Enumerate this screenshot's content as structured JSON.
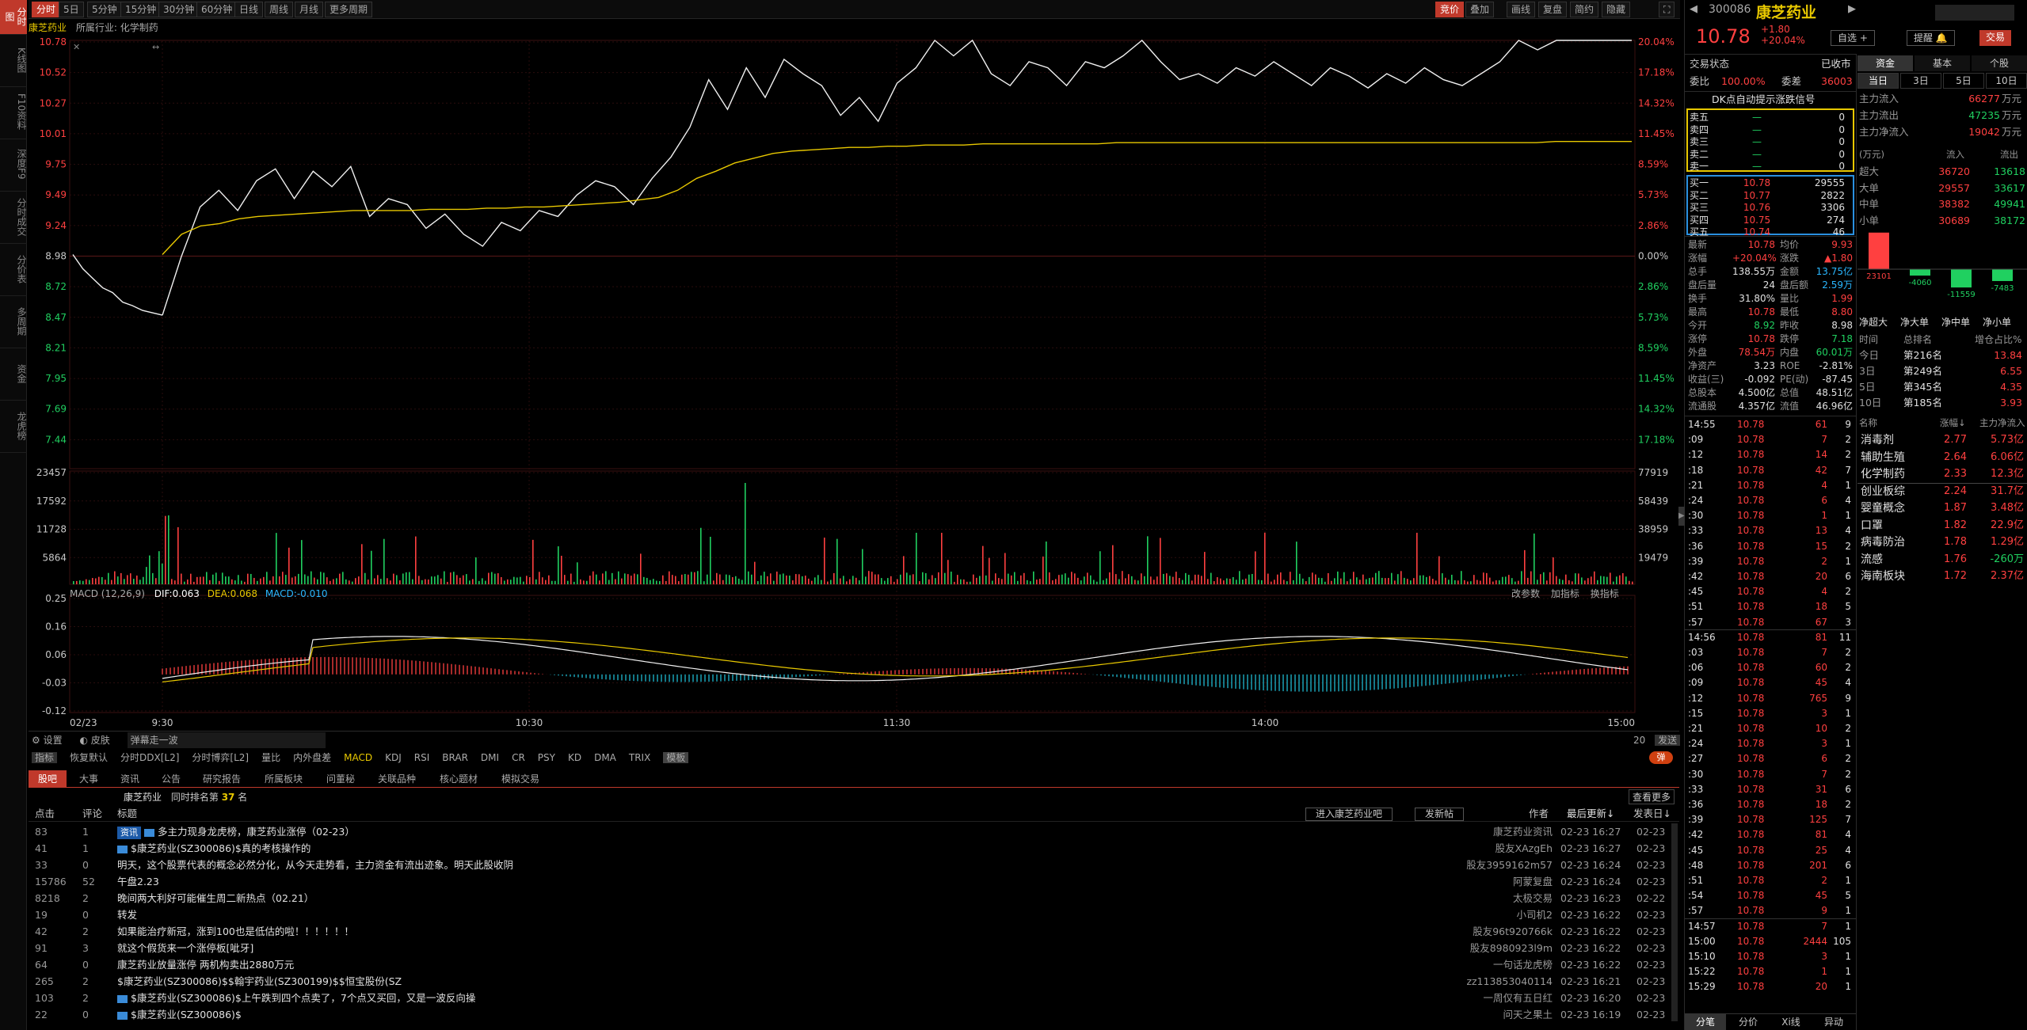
{
  "left_tabs": [
    {
      "label": "分时图",
      "active": true
    },
    {
      "label": "K线图",
      "active": false
    },
    {
      "label": "F10资料",
      "active": false
    },
    {
      "label": "深度F9",
      "active": false
    },
    {
      "label": "分时成交",
      "active": false
    },
    {
      "label": "分价表",
      "active": false
    },
    {
      "label": "多周期",
      "active": false
    },
    {
      "label": "资金",
      "active": false
    },
    {
      "label": "龙虎榜",
      "active": false
    }
  ],
  "period_buttons": [
    "分时",
    "5日",
    "5分钟",
    "15分钟",
    "30分钟",
    "60分钟",
    "日线",
    "周线",
    "月线",
    "更多周期"
  ],
  "right_buttons": [
    "竞价",
    "叠加",
    "画线",
    "复盘",
    "简约",
    "隐藏"
  ],
  "info": {
    "name": "康芝药业",
    "industry_label": "所属行业:",
    "industry": "化学制药"
  },
  "price_axis_left": [
    "10.78",
    "10.52",
    "10.27",
    "10.01",
    "9.75",
    "9.49",
    "9.24",
    "8.98",
    "8.72",
    "8.47",
    "8.21",
    "7.95",
    "7.69",
    "7.44"
  ],
  "pct_axis_right": [
    "20.04%",
    "17.18%",
    "14.32%",
    "11.45%",
    "8.59%",
    "5.73%",
    "2.86%",
    "0.00%",
    "2.86%",
    "5.73%",
    "8.59%",
    "11.45%",
    "14.32%",
    "17.18%"
  ],
  "vol_axis_left": [
    "23457",
    "17592",
    "11728",
    "5864"
  ],
  "vol_axis_right": [
    "77919",
    "58439",
    "38959",
    "19479"
  ],
  "macd": {
    "header": "MACD (12,26,9)",
    "dif_label": "DIF:",
    "dif": "0.063",
    "dea_label": "DEA:",
    "dea": "0.068",
    "macd_label": "MACD:",
    "macd_val": "-0.010",
    "axis": [
      "0.25",
      "0.16",
      "0.06",
      "-0.03",
      "-0.12"
    ],
    "tools": [
      "改参数",
      "加指标",
      "换指标"
    ]
  },
  "time_axis": [
    "02/23",
    "9:30",
    "10:30",
    "11:30",
    "14:00",
    "15:00"
  ],
  "chart_data": {
    "type": "line",
    "title": "",
    "prev_close": 8.98,
    "ylim": [
      7.18,
      10.78
    ],
    "series": [
      {
        "name": "",
        "values": [
          8.98,
          8.86,
          8.78,
          8.7,
          8.66,
          8.58,
          8.55,
          8.51,
          8.49,
          8.47,
          8.96,
          9.38,
          9.52,
          9.35,
          9.6,
          9.7,
          9.45,
          9.68,
          9.55,
          9.72,
          9.3,
          9.45,
          9.4,
          9.2,
          9.32,
          9.15,
          9.05,
          9.25,
          9.18,
          9.35,
          9.3,
          9.48,
          9.6,
          9.55,
          9.4,
          9.62,
          9.8,
          10.05,
          10.45,
          10.2,
          10.55,
          10.3,
          10.62,
          10.5,
          10.4,
          10.15,
          10.3,
          10.1,
          10.42,
          10.55,
          10.78,
          10.65,
          10.78,
          10.5,
          10.4,
          10.6,
          10.55,
          10.4,
          10.6,
          10.55,
          10.65,
          10.78,
          10.6,
          10.45,
          10.5,
          10.42,
          10.55,
          10.48,
          10.6,
          10.5,
          10.4,
          10.55,
          10.48,
          10.38,
          10.5,
          10.42,
          10.55,
          10.45,
          10.4,
          10.5,
          10.6,
          10.78,
          10.7,
          10.78,
          10.78,
          10.78,
          10.78,
          10.78
        ]
      },
      {
        "name": "",
        "values": [
          8.98,
          8.98,
          8.98,
          8.98,
          8.98,
          8.98,
          8.98,
          8.98,
          8.98,
          8.98,
          8.98,
          9.15,
          9.22,
          9.24,
          9.28,
          9.3,
          9.31,
          9.32,
          9.33,
          9.34,
          9.35,
          9.35,
          9.35,
          9.35,
          9.36,
          9.36,
          9.36,
          9.37,
          9.37,
          9.38,
          9.38,
          9.39,
          9.4,
          9.41,
          9.42,
          9.44,
          9.46,
          9.52,
          9.62,
          9.68,
          9.75,
          9.79,
          9.83,
          9.85,
          9.86,
          9.87,
          9.88,
          9.88,
          9.89,
          9.89,
          9.9,
          9.9,
          9.9,
          9.91,
          9.91,
          9.91,
          9.91,
          9.91,
          9.91,
          9.91,
          9.92,
          9.92,
          9.92,
          9.92,
          9.92,
          9.92,
          9.92,
          9.92,
          9.92,
          9.92,
          9.92,
          9.92,
          9.92,
          9.92,
          9.92,
          9.92,
          9.92,
          9.92,
          9.92,
          9.92,
          9.92,
          9.92,
          9.92,
          9.93,
          9.93,
          9.93,
          9.93,
          9.93
        ]
      }
    ]
  },
  "bottom_toolbar": {
    "settings": "设置",
    "skin": "皮肤",
    "marquee": "弹幕走一波",
    "count": "20",
    "send": "发送"
  },
  "indicator_tabs": [
    "指标",
    "恢复默认",
    "分时DDX[L2]",
    "分时博弈[L2]",
    "量比",
    "内外盘差",
    "MACD",
    "KDJ",
    "RSI",
    "BRAR",
    "DMI",
    "CR",
    "PSY",
    "KD",
    "DMA",
    "TRIX",
    "模板"
  ],
  "news_tabs": [
    "股吧",
    "大事",
    "资讯",
    "公告",
    "研究报告",
    "所属板块",
    "问董秘",
    "关联品种",
    "核心题材",
    "模拟交易"
  ],
  "news_subheader": {
    "stock": "康芝药业",
    "rank_label": "同时排名第",
    "rank": "37",
    "rank_suffix": "名",
    "more": "查看更多"
  },
  "news_columns": {
    "clicks": "点击",
    "comments": "评论",
    "title": "标题",
    "enter_bar": "进入康芝药业吧",
    "post": "发新帖",
    "author": "作者",
    "last_update": "最后更新↓",
    "posted": "发表日↓"
  },
  "news": [
    {
      "clicks": "83",
      "comments": "1",
      "tag": "资讯",
      "icon": true,
      "title": "多主力现身龙虎榜，康芝药业涨停（02-23）",
      "author": "康芝药业资讯",
      "update": "02-23 16:27",
      "date": "02-23"
    },
    {
      "clicks": "41",
      "comments": "1",
      "tag": "",
      "icon": true,
      "title": "$康芝药业(SZ300086)$真的考核操作的",
      "author": "股友XAzgEh",
      "update": "02-23 16:27",
      "date": "02-23"
    },
    {
      "clicks": "33",
      "comments": "0",
      "tag": "",
      "icon": false,
      "title": "明天，这个股票代表的概念必然分化，从今天走势看，主力资金有流出迹象。明天此股收阴",
      "author": "股友3959162m57",
      "update": "02-23 16:24",
      "date": "02-23"
    },
    {
      "clicks": "15786",
      "comments": "52",
      "tag": "",
      "icon": false,
      "title": "午盘2.23",
      "author": "阿蒙复盘",
      "update": "02-23 16:24",
      "date": "02-23"
    },
    {
      "clicks": "8218",
      "comments": "2",
      "tag": "",
      "icon": false,
      "title": "晚间两大利好可能催生周二新热点（02.21）",
      "author": "太极交易",
      "update": "02-23 16:23",
      "date": "02-22"
    },
    {
      "clicks": "19",
      "comments": "0",
      "tag": "",
      "icon": false,
      "title": "转发",
      "author": "小司机2",
      "update": "02-23 16:22",
      "date": "02-23"
    },
    {
      "clicks": "42",
      "comments": "2",
      "tag": "",
      "icon": false,
      "title": "如果能治疗新冠，涨到100也是低估的啦！！！！！！",
      "author": "股友96t920766k",
      "update": "02-23 16:22",
      "date": "02-23"
    },
    {
      "clicks": "91",
      "comments": "3",
      "tag": "",
      "icon": false,
      "title": "就这个假货来一个涨停板[呲牙]",
      "author": "股友8980923l9m",
      "update": "02-23 16:22",
      "date": "02-23"
    },
    {
      "clicks": "64",
      "comments": "0",
      "tag": "",
      "icon": false,
      "title": "康芝药业放量涨停 两机构卖出2880万元",
      "author": "一句话龙虎榜",
      "update": "02-23 16:22",
      "date": "02-23"
    },
    {
      "clicks": "265",
      "comments": "2",
      "tag": "",
      "icon": false,
      "title": "$康芝药业(SZ300086)$$翰宇药业(SZ300199)$$恒宝股份(SZ",
      "author": "zz113853040114",
      "update": "02-23 16:21",
      "date": "02-23"
    },
    {
      "clicks": "103",
      "comments": "2",
      "tag": "",
      "icon": true,
      "title": "$康芝药业(SZ300086)$上午跌到四个点卖了，7个点又买回，又是一波反向操",
      "author": "一周仅有五日红",
      "update": "02-23 16:20",
      "date": "02-23"
    },
    {
      "clicks": "22",
      "comments": "0",
      "tag": "",
      "icon": true,
      "title": "$康芝药业(SZ300086)$",
      "author": "问天之果土",
      "update": "02-23 16:19",
      "date": "02-23"
    }
  ],
  "quote": {
    "code": "300086",
    "name": "康芝药业",
    "price": "10.78",
    "change": "+1.80",
    "change_pct": "+20.04%",
    "btn_watch": "自选 +",
    "btn_alert": "提醒",
    "btn_trade": "交易",
    "status_label": "交易状态",
    "status": "已收市",
    "weibi_label": "委比",
    "weibi": "100.00%",
    "weicha_label": "委差",
    "weicha": "36003",
    "signal": "DK点自动提示涨跌信号",
    "asks": [
      {
        "label": "卖五",
        "price": "—",
        "vol": "0"
      },
      {
        "label": "卖四",
        "price": "—",
        "vol": "0"
      },
      {
        "label": "卖三",
        "price": "—",
        "vol": "0"
      },
      {
        "label": "卖二",
        "price": "—",
        "vol": "0"
      },
      {
        "label": "卖一",
        "price": "—",
        "vol": "0"
      }
    ],
    "bids": [
      {
        "label": "买一",
        "price": "10.78",
        "vol": "29555"
      },
      {
        "label": "买二",
        "price": "10.77",
        "vol": "2822"
      },
      {
        "label": "买三",
        "price": "10.76",
        "vol": "3306"
      },
      {
        "label": "买四",
        "price": "10.75",
        "vol": "274"
      },
      {
        "label": "买五",
        "price": "10.74",
        "vol": "46"
      }
    ],
    "stats": [
      [
        "最新",
        "10.78",
        "r",
        "均价",
        "9.93",
        "r"
      ],
      [
        "涨幅",
        "+20.04%",
        "r",
        "涨跌",
        "▲1.80",
        "r"
      ],
      [
        "总手",
        "138.55万",
        "w",
        "金额",
        "13.75亿",
        "cy"
      ],
      [
        "盘后量",
        "24",
        "w",
        "盘后额",
        "2.59万",
        "cy"
      ],
      [
        "换手",
        "31.80%",
        "w",
        "量比",
        "1.99",
        "r"
      ],
      [
        "最高",
        "10.78",
        "r",
        "最低",
        "8.80",
        "r"
      ],
      [
        "今开",
        "8.92",
        "g",
        "昨收",
        "8.98",
        "w"
      ],
      [
        "涨停",
        "10.78",
        "r",
        "跌停",
        "7.18",
        "g"
      ],
      [
        "外盘",
        "78.54万",
        "r",
        "内盘",
        "60.01万",
        "g"
      ],
      [
        "净资产",
        "3.23",
        "w",
        "ROE",
        "-2.81%",
        "w"
      ],
      [
        "收益(三)",
        "-0.092",
        "w",
        "PE(动)",
        "-87.45",
        "w"
      ],
      [
        "总股本",
        "4.500亿",
        "w",
        "总值",
        "48.51亿",
        "w"
      ],
      [
        "流通股",
        "4.357亿",
        "w",
        "流值",
        "46.96亿",
        "w"
      ]
    ]
  },
  "ticks": [
    {
      "t": "14:55",
      "p": "10.78",
      "v": "61",
      "n": "9"
    },
    {
      "t": ":09",
      "p": "10.78",
      "v": "7",
      "n": "2"
    },
    {
      "t": ":12",
      "p": "10.78",
      "v": "14",
      "n": "2"
    },
    {
      "t": ":18",
      "p": "10.78",
      "v": "42",
      "n": "7"
    },
    {
      "t": ":21",
      "p": "10.78",
      "v": "4",
      "n": "1"
    },
    {
      "t": ":24",
      "p": "10.78",
      "v": "6",
      "n": "4"
    },
    {
      "t": ":30",
      "p": "10.78",
      "v": "1",
      "n": "1"
    },
    {
      "t": ":33",
      "p": "10.78",
      "v": "13",
      "n": "4"
    },
    {
      "t": ":36",
      "p": "10.78",
      "v": "15",
      "n": "2"
    },
    {
      "t": ":39",
      "p": "10.78",
      "v": "2",
      "n": "1"
    },
    {
      "t": ":42",
      "p": "10.78",
      "v": "20",
      "n": "6"
    },
    {
      "t": ":45",
      "p": "10.78",
      "v": "4",
      "n": "2"
    },
    {
      "t": ":51",
      "p": "10.78",
      "v": "18",
      "n": "5"
    },
    {
      "t": ":57",
      "p": "10.78",
      "v": "67",
      "n": "3"
    },
    {
      "t": "14:56",
      "p": "10.78",
      "v": "81",
      "n": "11"
    },
    {
      "t": ":03",
      "p": "10.78",
      "v": "7",
      "n": "2"
    },
    {
      "t": ":06",
      "p": "10.78",
      "v": "60",
      "n": "2"
    },
    {
      "t": ":09",
      "p": "10.78",
      "v": "45",
      "n": "4"
    },
    {
      "t": ":12",
      "p": "10.78",
      "v": "765",
      "n": "9"
    },
    {
      "t": ":15",
      "p": "10.78",
      "v": "3",
      "n": "1"
    },
    {
      "t": ":21",
      "p": "10.78",
      "v": "10",
      "n": "2"
    },
    {
      "t": ":24",
      "p": "10.78",
      "v": "3",
      "n": "1"
    },
    {
      "t": ":27",
      "p": "10.78",
      "v": "6",
      "n": "2"
    },
    {
      "t": ":30",
      "p": "10.78",
      "v": "7",
      "n": "2"
    },
    {
      "t": ":33",
      "p": "10.78",
      "v": "31",
      "n": "6"
    },
    {
      "t": ":36",
      "p": "10.78",
      "v": "18",
      "n": "2"
    },
    {
      "t": ":39",
      "p": "10.78",
      "v": "125",
      "n": "7"
    },
    {
      "t": ":42",
      "p": "10.78",
      "v": "81",
      "n": "4"
    },
    {
      "t": ":45",
      "p": "10.78",
      "v": "25",
      "n": "4"
    },
    {
      "t": ":48",
      "p": "10.78",
      "v": "201",
      "n": "6"
    },
    {
      "t": ":51",
      "p": "10.78",
      "v": "2",
      "n": "1"
    },
    {
      "t": ":54",
      "p": "10.78",
      "v": "45",
      "n": "5"
    },
    {
      "t": ":57",
      "p": "10.78",
      "v": "9",
      "n": "1"
    },
    {
      "t": "14:57",
      "p": "10.78",
      "v": "7",
      "n": "1"
    },
    {
      "t": "15:00",
      "p": "10.78",
      "v": "2444",
      "n": "105"
    },
    {
      "t": "15:10",
      "p": "10.78",
      "v": "3",
      "n": "1"
    },
    {
      "t": "15:22",
      "p": "10.78",
      "v": "1",
      "n": "1"
    },
    {
      "t": "15:29",
      "p": "10.78",
      "v": "20",
      "n": "1"
    }
  ],
  "tick_tabs": [
    "分笔",
    "分价",
    "Xi线",
    "异动"
  ],
  "fund": {
    "tabs": [
      "资金",
      "基本",
      "个股"
    ],
    "period_tabs": [
      "当日",
      "3日",
      "5日",
      "10日"
    ],
    "flows": [
      {
        "label": "主力流入",
        "value": "66277",
        "unit": "万元",
        "c": "r"
      },
      {
        "label": "主力流出",
        "value": "47235",
        "unit": "万元",
        "c": "g"
      },
      {
        "label": "主力净流入",
        "value": "19042",
        "unit": "万元",
        "c": "r"
      }
    ],
    "table_head": [
      "(万元)",
      "流入",
      "流出"
    ],
    "table": [
      {
        "label": "超大",
        "in": "36720",
        "out": "13618"
      },
      {
        "label": "大单",
        "in": "29557",
        "out": "33617"
      },
      {
        "label": "中单",
        "in": "38382",
        "out": "49941"
      },
      {
        "label": "小单",
        "in": "30689",
        "out": "38172"
      }
    ],
    "net_values": [
      23101,
      -4060,
      -11559,
      -7483
    ],
    "net_labels": [
      "净超大",
      "净大单",
      "净中单",
      "净小单"
    ],
    "rank_head": [
      "时间",
      "总排名",
      "增仓占比%"
    ],
    "ranks": [
      {
        "t": "今日",
        "r": "第216名",
        "p": "13.84"
      },
      {
        "t": "3日",
        "r": "第249名",
        "p": "6.55"
      },
      {
        "t": "5日",
        "r": "第345名",
        "p": "4.35"
      },
      {
        "t": "10日",
        "r": "第185名",
        "p": "3.93"
      }
    ],
    "sector_head": [
      "名称",
      "涨幅↓",
      "主力净流入"
    ],
    "sectors": [
      {
        "n": "消毒剂",
        "p": "2.77",
        "f": "5.73亿"
      },
      {
        "n": "辅助生殖",
        "p": "2.64",
        "f": "6.06亿"
      },
      {
        "n": "化学制药",
        "p": "2.33",
        "f": "12.3亿"
      },
      {
        "n": "创业板综",
        "p": "2.24",
        "f": "31.7亿"
      },
      {
        "n": "婴童概念",
        "p": "1.87",
        "f": "3.48亿"
      },
      {
        "n": "口罩",
        "p": "1.82",
        "f": "22.9亿"
      },
      {
        "n": "病毒防治",
        "p": "1.78",
        "f": "1.29亿"
      },
      {
        "n": "流感",
        "p": "1.76",
        "f": "-260万"
      },
      {
        "n": "海南板块",
        "p": "1.72",
        "f": "2.37亿"
      }
    ]
  }
}
